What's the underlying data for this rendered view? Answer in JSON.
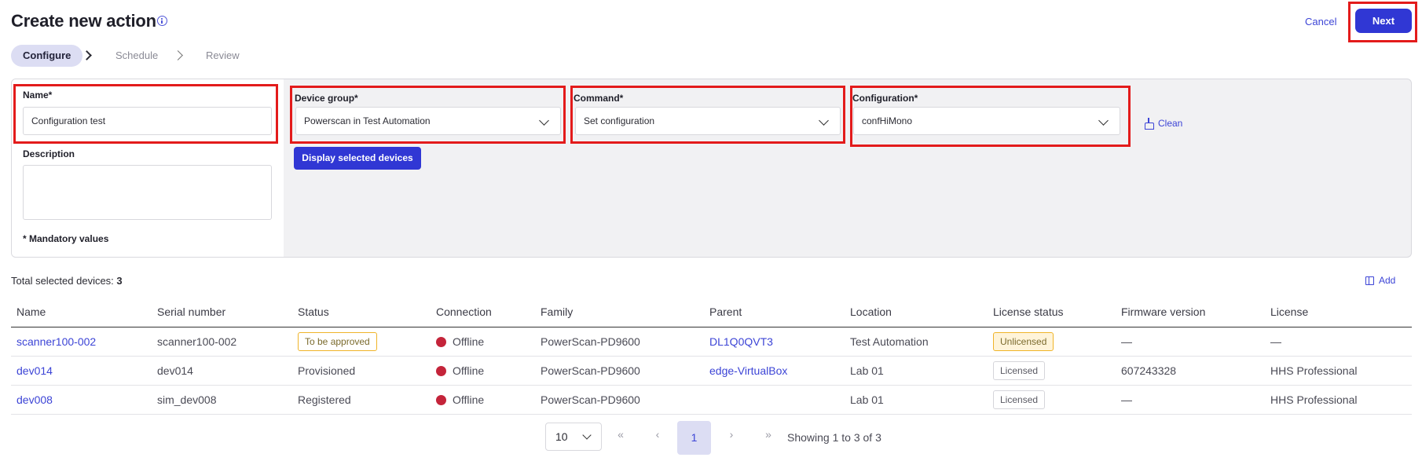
{
  "header": {
    "title": "Create new action",
    "cancel_label": "Cancel",
    "next_label": "Next"
  },
  "stepper": {
    "steps": [
      {
        "label": "Configure",
        "active": true
      },
      {
        "label": "Schedule",
        "active": false
      },
      {
        "label": "Review",
        "active": false
      }
    ]
  },
  "form": {
    "name_label": "Name*",
    "name_value": "Configuration test",
    "description_label": "Description",
    "description_value": "",
    "mandatory_note": "* Mandatory values",
    "device_group_label": "Device group*",
    "device_group_value": "Powerscan in Test Automation",
    "command_label": "Command*",
    "command_value": "Set configuration",
    "configuration_label": "Configuration*",
    "configuration_value": "confHiMono",
    "display_devices_label": "Display selected devices",
    "clean_label": "Clean"
  },
  "table": {
    "total_label": "Total selected devices:",
    "total_count": "3",
    "add_label": "Add",
    "columns": [
      "Name",
      "Serial number",
      "Status",
      "Connection",
      "Family",
      "Parent",
      "Location",
      "License status",
      "Firmware version",
      "License"
    ],
    "rows": [
      {
        "name": "scanner100-002",
        "serial": "scanner100-002",
        "status": "To be approved",
        "connection": "Offline",
        "family": "PowerScan-PD9600",
        "parent": "DL1Q0QVT3",
        "location": "Test Automation",
        "license_status": "Unlicensed",
        "firmware": "—",
        "license": "—"
      },
      {
        "name": "dev014",
        "serial": "dev014",
        "status": "Provisioned",
        "connection": "Offline",
        "family": "PowerScan-PD9600",
        "parent": "edge-VirtualBox",
        "location": "Lab 01",
        "license_status": "Licensed",
        "firmware": "607243328",
        "license": "HHS Professional"
      },
      {
        "name": "dev008",
        "serial": "sim_dev008",
        "status": "Registered",
        "connection": "Offline",
        "family": "PowerScan-PD9600",
        "parent": "",
        "location": "Lab 01",
        "license_status": "Licensed",
        "firmware": "—",
        "license": "HHS Professional"
      }
    ]
  },
  "pagination": {
    "page_size": "10",
    "first": "«",
    "prev": "‹",
    "current_page": "1",
    "next": "›",
    "last": "»",
    "showing": "Showing 1 to 3 of 3"
  },
  "colors": {
    "accent": "#3037d4",
    "highlight_border": "#e31b1b",
    "offline_dot": "#c4243a",
    "warning_border": "#f0b429"
  }
}
